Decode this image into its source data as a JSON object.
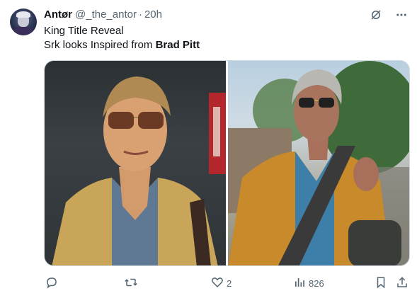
{
  "tweet": {
    "author_name": "Antør",
    "author_handle": "@_the_antor",
    "separator": "·",
    "time": "20h",
    "text_line1": "King Title Reveal",
    "text_line2_prefix": "Srk looks Inspired from ",
    "text_line2_bold": "Brad Pitt"
  },
  "icons": {
    "grok": "grok-icon",
    "more": "more-icon",
    "reply": "reply-icon",
    "retweet": "retweet-icon",
    "like": "heart-icon",
    "views": "views-icon",
    "bookmark": "bookmark-icon",
    "share": "share-icon"
  },
  "stats": {
    "likes": "2",
    "views": "826"
  }
}
